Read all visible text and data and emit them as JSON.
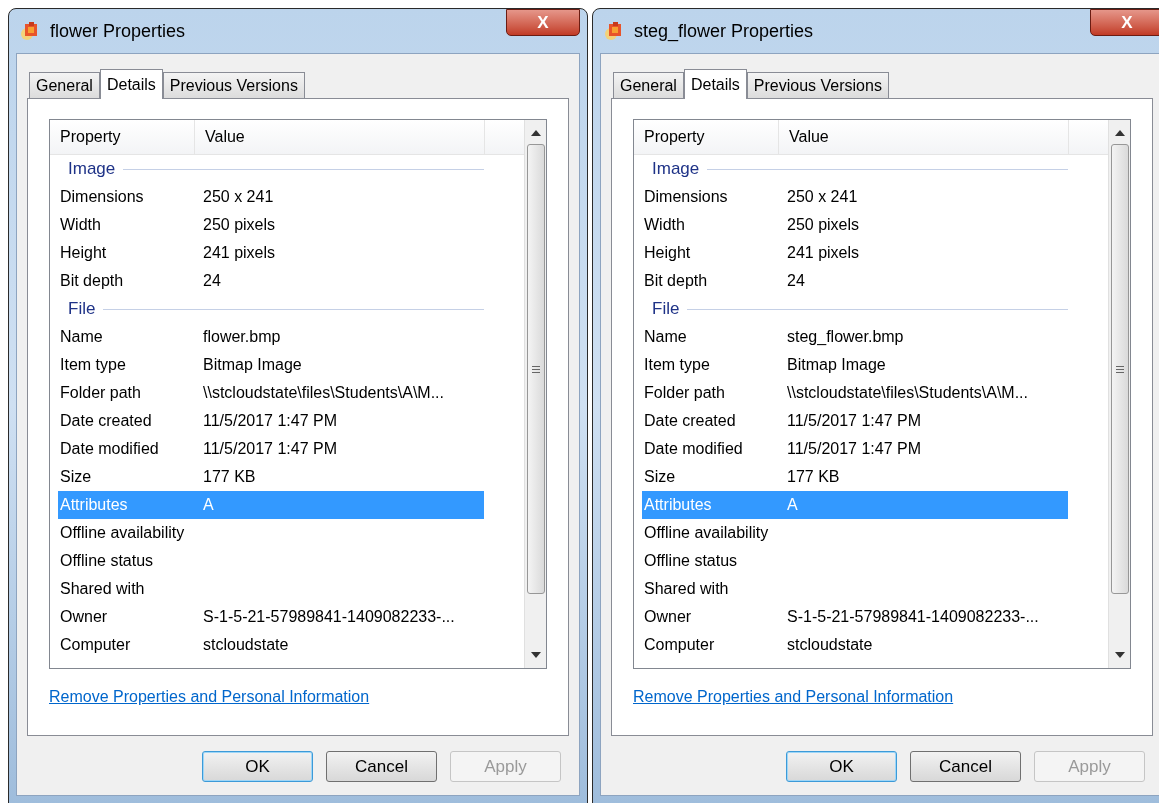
{
  "dialogs": [
    {
      "title": "flower Properties",
      "close": "X",
      "tabs": [
        {
          "label": "General",
          "selected": false
        },
        {
          "label": "Details",
          "selected": true
        },
        {
          "label": "Previous Versions",
          "selected": false
        }
      ],
      "columns": [
        "Property",
        "Value"
      ],
      "rows": [
        {
          "kind": "group",
          "label": "Image"
        },
        {
          "kind": "property",
          "label": "Dimensions",
          "value": "250 x 241",
          "selected": false
        },
        {
          "kind": "property",
          "label": "Width",
          "value": "250 pixels",
          "selected": false
        },
        {
          "kind": "property",
          "label": "Height",
          "value": "241 pixels",
          "selected": false
        },
        {
          "kind": "property",
          "label": "Bit depth",
          "value": "24",
          "selected": false
        },
        {
          "kind": "group",
          "label": "File"
        },
        {
          "kind": "property",
          "label": "Name",
          "value": "flower.bmp",
          "selected": false
        },
        {
          "kind": "property",
          "label": "Item type",
          "value": "Bitmap Image",
          "selected": false
        },
        {
          "kind": "property",
          "label": "Folder path",
          "value": "\\\\stcloudstate\\files\\Students\\A\\M...",
          "selected": false
        },
        {
          "kind": "property",
          "label": "Date created",
          "value": "11/5/2017 1:47 PM",
          "selected": false
        },
        {
          "kind": "property",
          "label": "Date modified",
          "value": "11/5/2017 1:47 PM",
          "selected": false
        },
        {
          "kind": "property",
          "label": "Size",
          "value": "177 KB",
          "selected": false
        },
        {
          "kind": "property",
          "label": "Attributes",
          "value": "A",
          "selected": true
        },
        {
          "kind": "property",
          "label": "Offline availability",
          "selected": false
        },
        {
          "kind": "property",
          "label": "Offline status",
          "selected": false
        },
        {
          "kind": "property",
          "label": "Shared with",
          "selected": false
        },
        {
          "kind": "property",
          "label": "Owner",
          "value": "S-1-5-21-57989841-1409082233-...",
          "selected": false
        },
        {
          "kind": "property",
          "label": "Computer",
          "value": "stcloudstate",
          "selected": false
        }
      ],
      "link": "Remove Properties and Personal Information",
      "buttons": [
        {
          "label": "OK",
          "default": true,
          "disabled": false
        },
        {
          "label": "Cancel",
          "default": false,
          "disabled": false
        },
        {
          "label": "Apply",
          "default": false,
          "disabled": true
        }
      ]
    },
    {
      "title": "steg_flower Properties",
      "close": "X",
      "tabs": [
        {
          "label": "General",
          "selected": false
        },
        {
          "label": "Details",
          "selected": true
        },
        {
          "label": "Previous Versions",
          "selected": false
        }
      ],
      "columns": [
        "Property",
        "Value"
      ],
      "rows": [
        {
          "kind": "group",
          "label": "Image"
        },
        {
          "kind": "property",
          "label": "Dimensions",
          "value": "250 x 241",
          "selected": false
        },
        {
          "kind": "property",
          "label": "Width",
          "value": "250 pixels",
          "selected": false
        },
        {
          "kind": "property",
          "label": "Height",
          "value": "241 pixels",
          "selected": false
        },
        {
          "kind": "property",
          "label": "Bit depth",
          "value": "24",
          "selected": false
        },
        {
          "kind": "group",
          "label": "File"
        },
        {
          "kind": "property",
          "label": "Name",
          "value": "steg_flower.bmp",
          "selected": false
        },
        {
          "kind": "property",
          "label": "Item type",
          "value": "Bitmap Image",
          "selected": false
        },
        {
          "kind": "property",
          "label": "Folder path",
          "value": "\\\\stcloudstate\\files\\Students\\A\\M...",
          "selected": false
        },
        {
          "kind": "property",
          "label": "Date created",
          "value": "11/5/2017 1:47 PM",
          "selected": false
        },
        {
          "kind": "property",
          "label": "Date modified",
          "value": "11/5/2017 1:47 PM",
          "selected": false
        },
        {
          "kind": "property",
          "label": "Size",
          "value": "177 KB",
          "selected": false
        },
        {
          "kind": "property",
          "label": "Attributes",
          "value": "A",
          "selected": true
        },
        {
          "kind": "property",
          "label": "Offline availability",
          "selected": false
        },
        {
          "kind": "property",
          "label": "Offline status",
          "selected": false
        },
        {
          "kind": "property",
          "label": "Shared with",
          "selected": false
        },
        {
          "kind": "property",
          "label": "Owner",
          "value": "S-1-5-21-57989841-1409082233-...",
          "selected": false
        },
        {
          "kind": "property",
          "label": "Computer",
          "value": "stcloudstate",
          "selected": false
        }
      ],
      "link": "Remove Properties and Personal Information",
      "buttons": [
        {
          "label": "OK",
          "default": true,
          "disabled": false
        },
        {
          "label": "Cancel",
          "default": false,
          "disabled": false
        },
        {
          "label": "Apply",
          "default": false,
          "disabled": true
        }
      ]
    }
  ]
}
